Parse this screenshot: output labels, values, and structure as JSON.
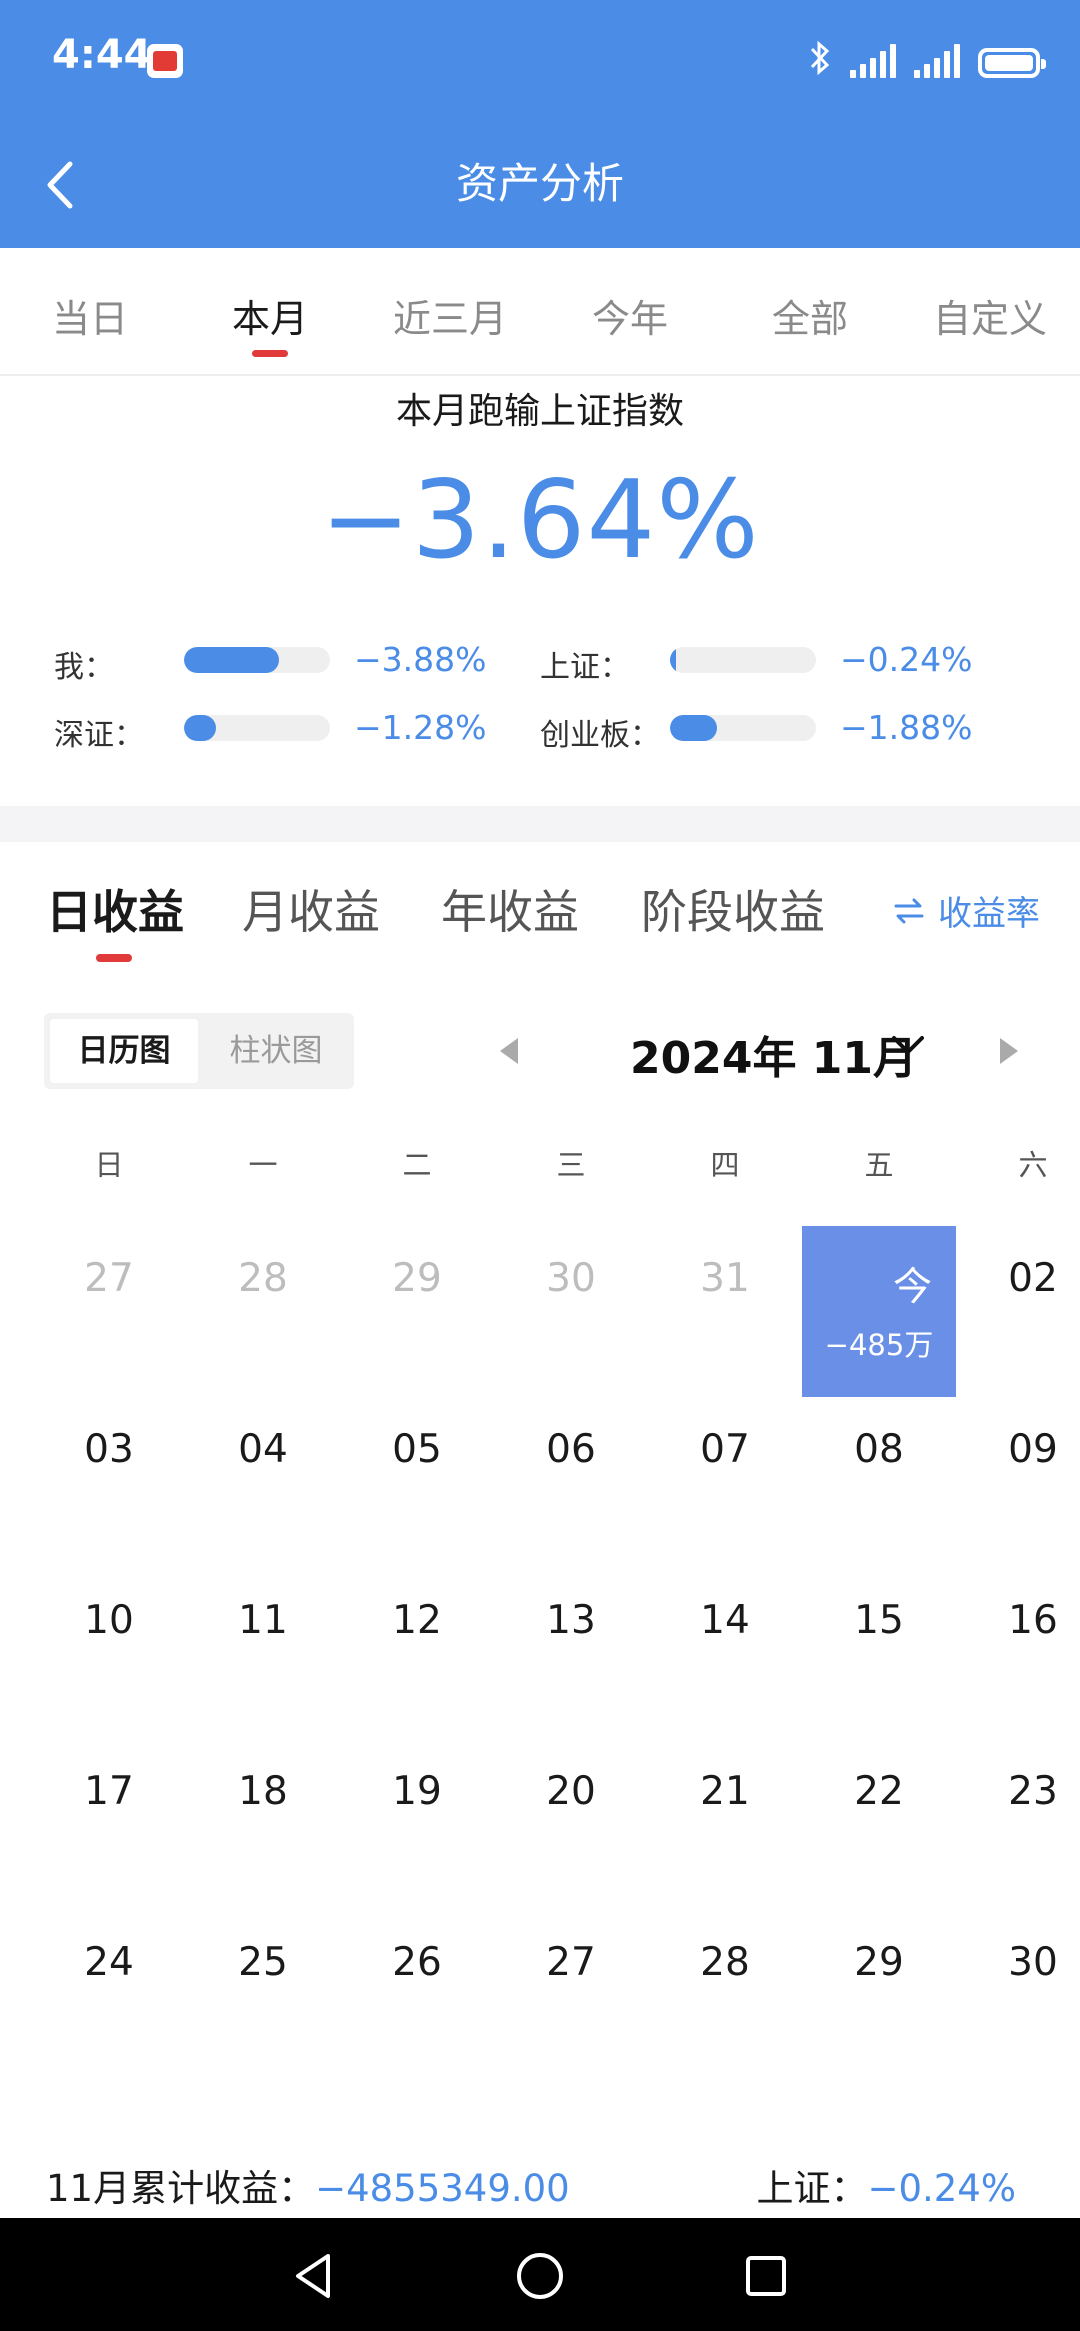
{
  "status_bar": {
    "time": "4:44",
    "icons": [
      "app-notification-icon",
      "bluetooth-icon",
      "signal-icon",
      "signal-icon",
      "battery-icon"
    ]
  },
  "header": {
    "title": "资产分析",
    "back_icon": "chevron-left-icon",
    "background": "#4a8ce6"
  },
  "period_tabs": [
    {
      "label": "当日",
      "active": false
    },
    {
      "label": "本月",
      "active": true
    },
    {
      "label": "近三月",
      "active": false
    },
    {
      "label": "今年",
      "active": false
    },
    {
      "label": "全部",
      "active": false
    },
    {
      "label": "自定义",
      "active": false
    }
  ],
  "comparison": {
    "title": "本月跑输上证指数",
    "value": "−3.64%",
    "rows": [
      {
        "label": "我：",
        "value": "−3.88%",
        "level": 0.65
      },
      {
        "label": "上证：",
        "value": "−0.24%",
        "level": 0.04
      },
      {
        "label": "深证：",
        "value": "−1.28%",
        "level": 0.22
      },
      {
        "label": "创业板：",
        "value": "−1.88%",
        "level": 0.32
      }
    ],
    "accent_color": "#4a8ce6"
  },
  "earnings_tabs": [
    {
      "label": "日收益",
      "active": true
    },
    {
      "label": "月收益",
      "active": false
    },
    {
      "label": "年收益",
      "active": false
    },
    {
      "label": "阶段收益",
      "active": false
    }
  ],
  "rate_toggle": {
    "label": "收益率",
    "icon": "swap-arrows-icon"
  },
  "view_toggle": {
    "calendar": "日历图",
    "bar": "柱状图",
    "selected": "日历图"
  },
  "calendar": {
    "month_label": "2024年 11月",
    "weekdays": [
      "日",
      "一",
      "二",
      "三",
      "四",
      "五",
      "六"
    ],
    "weeks": [
      [
        {
          "day": "27",
          "muted": true
        },
        {
          "day": "28",
          "muted": true
        },
        {
          "day": "29",
          "muted": true
        },
        {
          "day": "30",
          "muted": true
        },
        {
          "day": "31",
          "muted": true
        },
        {
          "day": "今",
          "today": true,
          "value": "−485万"
        },
        {
          "day": "02"
        }
      ],
      [
        {
          "day": "03"
        },
        {
          "day": "04"
        },
        {
          "day": "05"
        },
        {
          "day": "06"
        },
        {
          "day": "07"
        },
        {
          "day": "08"
        },
        {
          "day": "09"
        }
      ],
      [
        {
          "day": "10"
        },
        {
          "day": "11"
        },
        {
          "day": "12"
        },
        {
          "day": "13"
        },
        {
          "day": "14"
        },
        {
          "day": "15"
        },
        {
          "day": "16"
        }
      ],
      [
        {
          "day": "17"
        },
        {
          "day": "18"
        },
        {
          "day": "19"
        },
        {
          "day": "20"
        },
        {
          "day": "21"
        },
        {
          "day": "22"
        },
        {
          "day": "23"
        }
      ],
      [
        {
          "day": "24"
        },
        {
          "day": "25"
        },
        {
          "day": "26"
        },
        {
          "day": "27"
        },
        {
          "day": "28"
        },
        {
          "day": "29"
        },
        {
          "day": "30"
        }
      ]
    ],
    "today_color": "#6a8fe6"
  },
  "summary": {
    "left_label": "11月累计收益：",
    "left_value": "−4855349.00",
    "right_label": "上证：",
    "right_value": "−0.24%"
  },
  "nav_bar": {
    "buttons": [
      "back-triangle-icon",
      "home-circle-icon",
      "recents-square-icon"
    ]
  }
}
